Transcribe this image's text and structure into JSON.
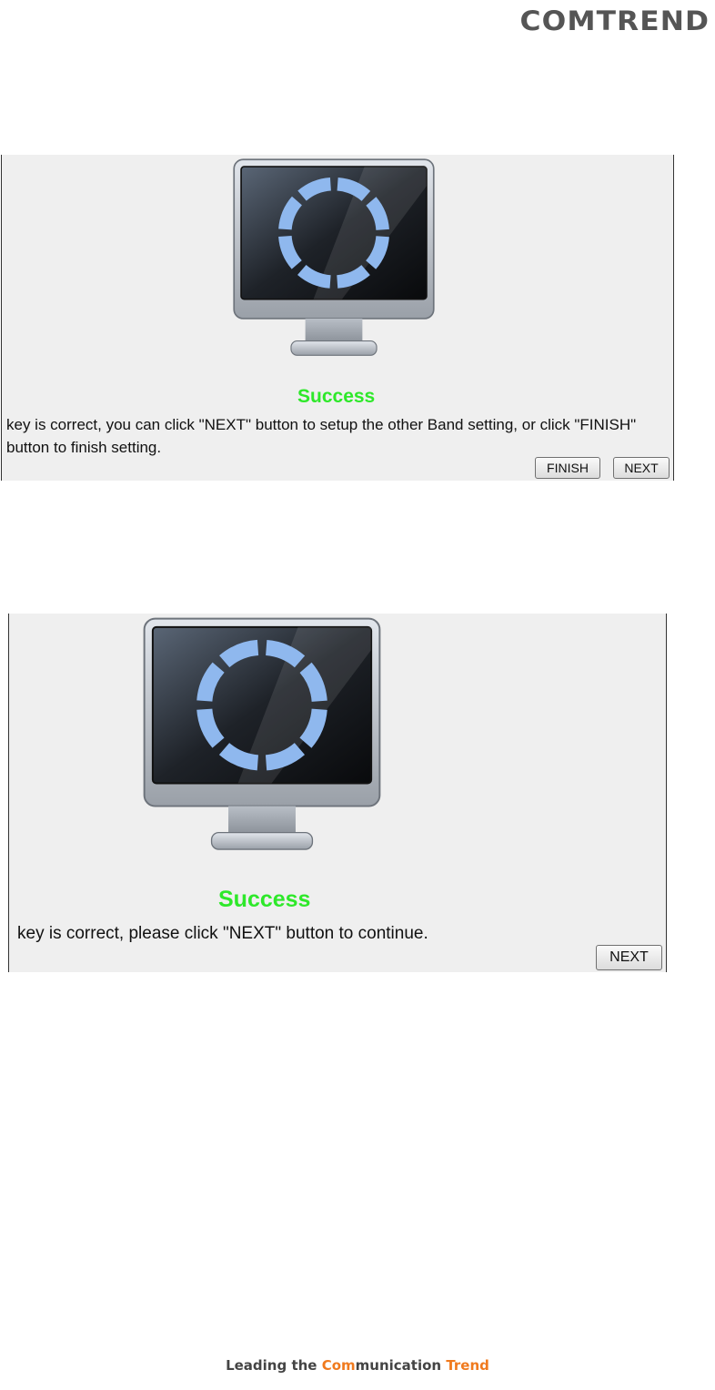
{
  "header": {
    "logo_text": "COMTREND"
  },
  "dialogs": [
    {
      "title": "Success",
      "message": "key is correct, you can click \"NEXT\" button to setup the other Band setting, or click \"FINISH\" button to finish setting.",
      "buttons": {
        "finish": "FINISH",
        "next": "NEXT"
      }
    },
    {
      "title": "Success",
      "message": "key is correct, please click \"NEXT\" button to continue.",
      "buttons": {
        "next": "NEXT"
      }
    }
  ],
  "footer": {
    "part1": "Leading the ",
    "part2_orange": "Com",
    "part3": "munication ",
    "part4_orange": "Trend"
  },
  "colors": {
    "success": "#2ee82a",
    "accent": "#f07a1e",
    "ring": "#8fb8ee"
  }
}
